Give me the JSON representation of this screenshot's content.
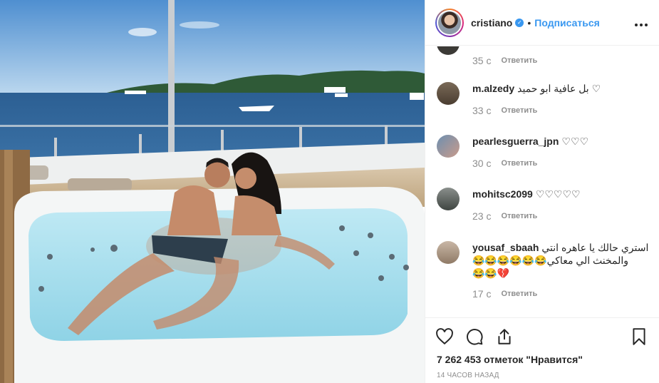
{
  "post": {
    "image_alt": "Couple kissing in a yacht jacuzzi",
    "header": {
      "username": "cristiano",
      "verified_icon": "verified-badge-icon",
      "separator": "•",
      "follow_label": "Подписаться",
      "more_label": "•••"
    },
    "comments": [
      {
        "username": "",
        "text": "",
        "time": "35 с",
        "reply_label": "Ответить"
      },
      {
        "username": "m.alzedy",
        "text": "بل عافية ابو حميد ♡",
        "time": "33 с",
        "reply_label": "Ответить"
      },
      {
        "username": "pearlesguerra_jpn",
        "text": "♡♡♡",
        "time": "30 с",
        "reply_label": "Ответить"
      },
      {
        "username": "mohitsc2099",
        "text": "♡♡♡♡♡",
        "time": "23 с",
        "reply_label": "Ответить"
      },
      {
        "username": "yousaf_sbaah",
        "text": "استري حالك يا عاهره انتي",
        "text2": "والمخنث الي معاكي😂😂😂😂😂😂",
        "text3": "😂😂💔",
        "time": "17 с",
        "reply_label": "Ответить"
      }
    ],
    "actions": {
      "like_icon": "heart-icon",
      "comment_icon": "comment-icon",
      "share_icon": "share-icon",
      "save_icon": "bookmark-icon"
    },
    "likes_text": "7 262 453 отметок \"Нравится\"",
    "time_ago": "14 часов назад"
  }
}
